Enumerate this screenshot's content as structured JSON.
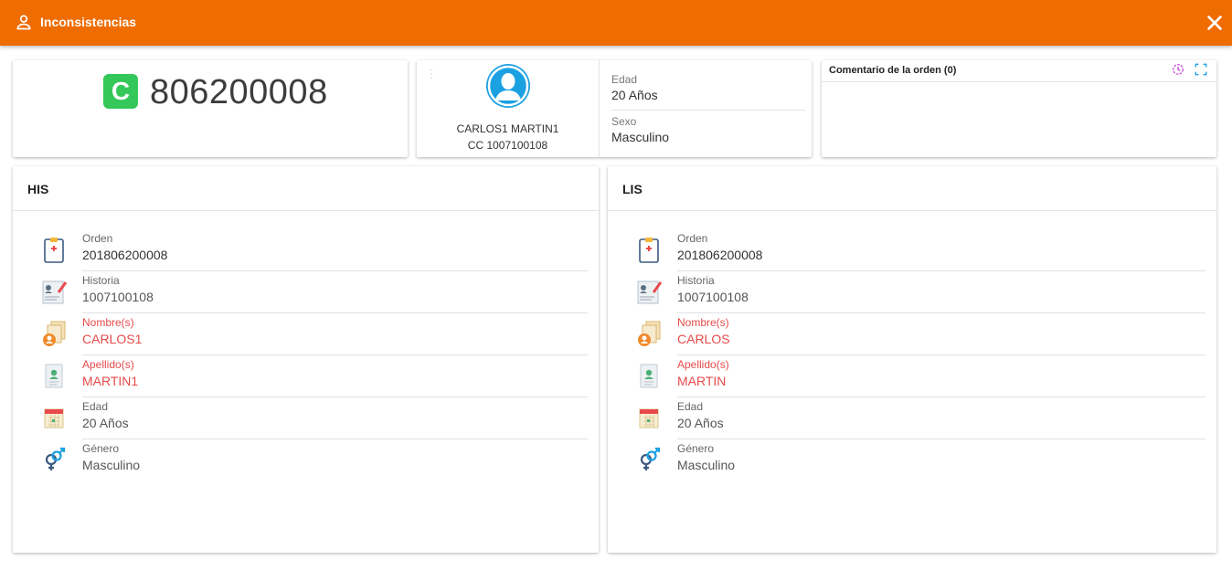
{
  "header": {
    "title": "Inconsistencias",
    "accent": "#ef6c00"
  },
  "order": {
    "badge": "C",
    "number": "806200008"
  },
  "patient": {
    "name": "CARLOS1 MARTIN1",
    "document": "CC 1007100108",
    "age_label": "Edad",
    "age_value": "20 Años",
    "sex_label": "Sexo",
    "sex_value": "Masculino"
  },
  "comment": {
    "title": "Comentario de la orden (0)"
  },
  "his": {
    "title": "HIS",
    "rows": [
      {
        "label": "Orden",
        "value": "201806200008",
        "icon": "clipboard-icon"
      },
      {
        "label": "Historia",
        "value": "1007100108",
        "icon": "medical-record-icon"
      },
      {
        "label": "Nombre(s)",
        "value": "CARLOS1",
        "icon": "person-documents-icon"
      },
      {
        "label": "Apellido(s)",
        "value": "MARTIN1",
        "icon": "id-card-icon"
      },
      {
        "label": "Edad",
        "value": "20 Años",
        "icon": "calendar-icon"
      },
      {
        "label": "Género",
        "value": "Masculino",
        "icon": "gender-icon"
      }
    ]
  },
  "lis": {
    "title": "LIS",
    "rows": [
      {
        "label": "Orden",
        "value": "201806200008",
        "icon": "clipboard-icon"
      },
      {
        "label": "Historia",
        "value": "1007100108",
        "icon": "medical-record-icon"
      },
      {
        "label": "Nombre(s)",
        "value": "CARLOS",
        "icon": "person-documents-icon"
      },
      {
        "label": "Apellido(s)",
        "value": "MARTIN",
        "icon": "id-card-icon"
      },
      {
        "label": "Edad",
        "value": "20 Años",
        "icon": "calendar-icon"
      },
      {
        "label": "Género",
        "value": "Masculino",
        "icon": "gender-icon"
      }
    ]
  },
  "colors": {
    "mismatch": "#e84a4a",
    "badge": "#34c759",
    "avatar": "#1ba1e2"
  }
}
